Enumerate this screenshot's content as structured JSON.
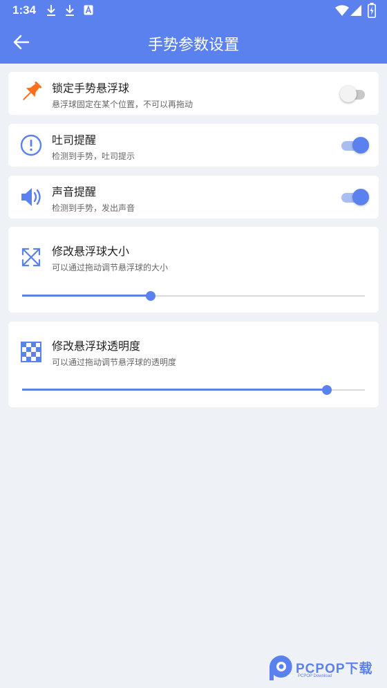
{
  "status_bar": {
    "time": "1:34",
    "notification_icons": [
      "download-icon",
      "download-icon",
      "text-a-icon"
    ],
    "system_icons": [
      "wifi-icon",
      "cell-signal-icon",
      "battery-charging-icon"
    ]
  },
  "app_bar": {
    "title": "手势参数设置",
    "back_icon": "arrow-back-icon"
  },
  "settings": {
    "lock": {
      "label": "锁定手势悬浮球",
      "description": "悬浮球固定在某个位置，不可以再拖动",
      "icon": "pin-icon",
      "enabled": false
    },
    "toast": {
      "label": "吐司提醒",
      "description": "检测到手势，吐司提示",
      "icon": "alert-circle-icon",
      "enabled": true
    },
    "sound": {
      "label": "声音提醒",
      "description": "检测到手势，发出声音",
      "icon": "speaker-icon",
      "enabled": true
    },
    "size": {
      "label": "修改悬浮球大小",
      "description": "可以通过拖动调节悬浮球的大小",
      "icon": "expand-arrows-icon",
      "value": 0.375
    },
    "opacity": {
      "label": "修改悬浮球透明度",
      "description": "可以通过拖动调节悬浮球的透明度",
      "icon": "checkerboard-icon",
      "value": 0.89
    }
  },
  "watermark": {
    "text": "PCPOP下载",
    "subtext": "PCPOP Download"
  },
  "colors": {
    "primary": "#5a81ee",
    "pin": "#ff6f1a",
    "background": "#eef1f5"
  }
}
